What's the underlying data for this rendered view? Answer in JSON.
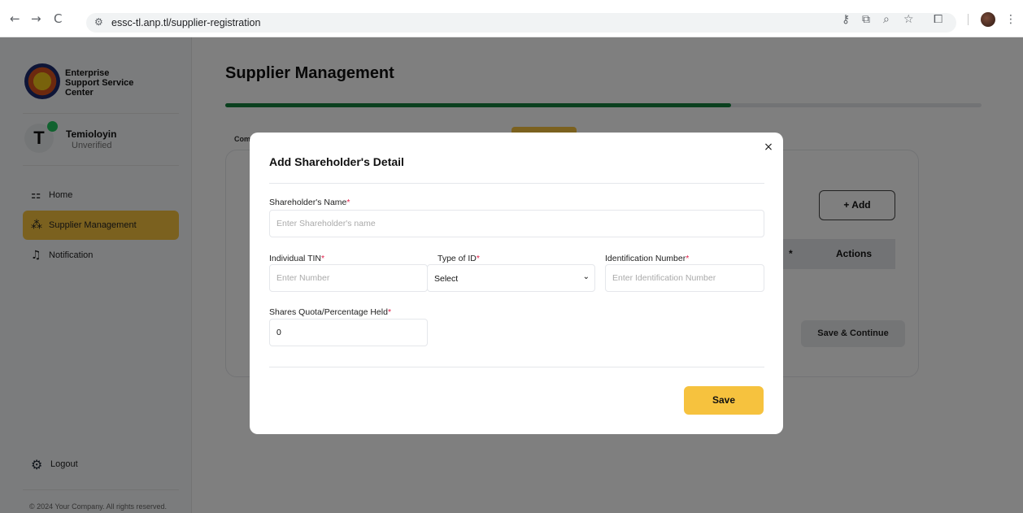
{
  "browser": {
    "back_icon": "←",
    "forward_icon": "→",
    "reload_icon": "C",
    "site_icon": "⚙",
    "url": "essc-tl.anp.tl/supplier-registration",
    "right_icons": [
      "key-icon",
      "install-icon",
      "zoom-icon",
      "star-icon",
      "extensions-icon",
      "menu-icon"
    ]
  },
  "sidebar": {
    "brand_line1": "Enterprise",
    "brand_line2": "Support Service",
    "brand_line3": "Center",
    "user_initial": "T",
    "user_name": "Temioloyin",
    "user_status": "Unverified",
    "menu": [
      {
        "label": "Home",
        "icon": "grid-icon",
        "active": false
      },
      {
        "label": "Supplier Management",
        "icon": "users-icon",
        "active": true
      },
      {
        "label": "Notification",
        "icon": "bell-icon",
        "active": false
      }
    ],
    "logout_label": "Logout",
    "footer": "© 2024 Your Company. All rights reserved."
  },
  "main": {
    "title": "Supplier Management",
    "progress_fraction": 0.669,
    "step_label": "Com",
    "add_button": "+ Add",
    "table_actions_header": "Actions",
    "table_mark": "*",
    "save_continue": "Save & Continue"
  },
  "modal": {
    "title": "Add Shareholder's Detail",
    "close_icon": "×",
    "shareholder_name_label": "Shareholder's Name",
    "shareholder_name_placeholder": "Enter Shareholder's name",
    "tin_label": "Individual TIN",
    "tin_placeholder": "Enter Number",
    "id_type_label": "Type of ID",
    "id_type_value": "Select",
    "id_number_label": "Identification Number",
    "id_number_placeholder": "Enter Identification Number",
    "shares_label": "Shares Quota/Percentage Held",
    "shares_value": "0",
    "required_mark": "*",
    "save_button": "Save"
  },
  "colors": {
    "accent": "#f6c23e",
    "progress": "#15803d",
    "required": "#e11d48"
  }
}
